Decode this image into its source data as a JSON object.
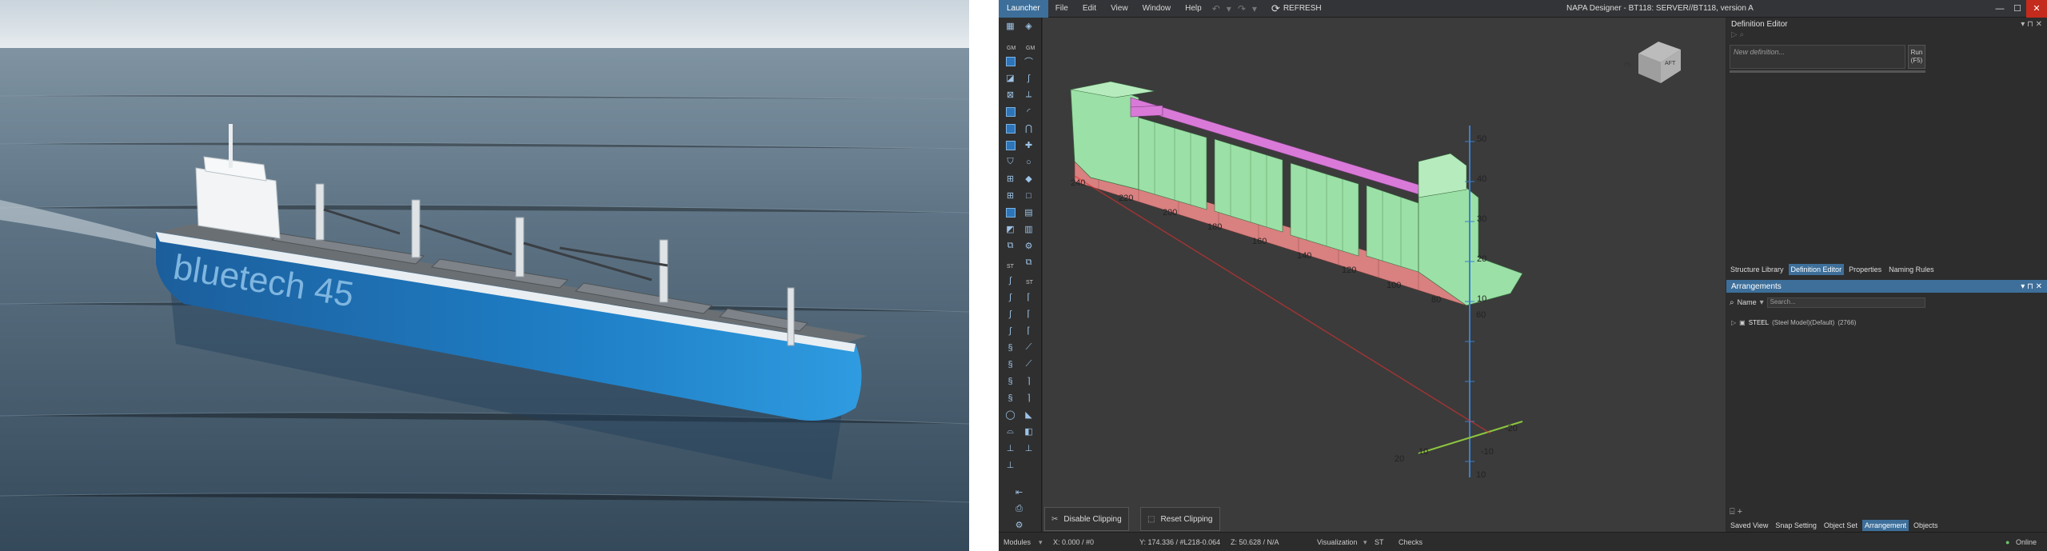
{
  "photo": {
    "hull_name": "bluetech 45",
    "hull_color": "#1f7fc6"
  },
  "app": {
    "menu": {
      "launcher": "Launcher",
      "items": [
        "File",
        "Edit",
        "View",
        "Window",
        "Help"
      ],
      "refresh": "REFRESH"
    },
    "window_title": "NAPA Designer - BT118: SERVER//BT118, version A",
    "toolbar": {
      "section_labels": [
        "GM",
        "GM",
        "ST",
        "ST"
      ]
    },
    "viewport": {
      "nav_cube": {
        "top": "TOP",
        "left": "PS",
        "right": "AFT"
      },
      "frame_labels": [
        "240",
        "230",
        "220",
        "210",
        "200",
        "190",
        "180",
        "170",
        "160",
        "150",
        "140",
        "130",
        "120",
        "110",
        "100",
        "90",
        "80",
        "70",
        "60",
        "50",
        "40",
        "30",
        "20",
        "10"
      ],
      "vertical_labels": [
        "50",
        "40",
        "30",
        "20",
        "10"
      ],
      "transverse_labels": [
        "20",
        "10",
        "-10",
        "-20",
        "-10",
        "10"
      ],
      "disable_clipping": "Disable Clipping",
      "reset_clipping": "Reset Clipping"
    },
    "definition_editor": {
      "title": "Definition Editor",
      "input_placeholder": "New definition...",
      "run_label": "Run",
      "run_key": "(F5)"
    },
    "top_tabs": [
      {
        "label": "Structure Library",
        "active": false
      },
      {
        "label": "Definition Editor",
        "active": true
      },
      {
        "label": "Properties",
        "active": false
      },
      {
        "label": "Naming Rules",
        "active": false
      }
    ],
    "arrangements": {
      "title": "Arrangements",
      "name_filter": "Name",
      "search_placeholder": "Search...",
      "tree_item": "STEEL",
      "tree_item_detail": "(Steel Model)(Default)",
      "tree_item_count": "(2766)"
    },
    "bottom_tabs": [
      {
        "label": "Saved View",
        "active": false
      },
      {
        "label": "Snap Setting",
        "active": false
      },
      {
        "label": "Object Set",
        "active": false
      },
      {
        "label": "Arrangement",
        "active": true
      },
      {
        "label": "Objects",
        "active": false
      }
    ],
    "status": {
      "modules": "Modules",
      "x": "X:  0.000 / #0",
      "y": "Y:  174.336 / #L218-0.064",
      "z": "Z:  50.628 / N/A",
      "visualization": "Visualization",
      "st": "ST",
      "checks": "Checks",
      "online": "Online"
    },
    "colors": {
      "accent": "#3d6f9a",
      "deck_magenta": "#d97ad9",
      "plate_green": "#9be0a6",
      "bottom_red": "#d98080",
      "axis_blue": "#3a7fd0",
      "axis_green": "#8dc63f",
      "axis_red": "#e03030"
    }
  }
}
